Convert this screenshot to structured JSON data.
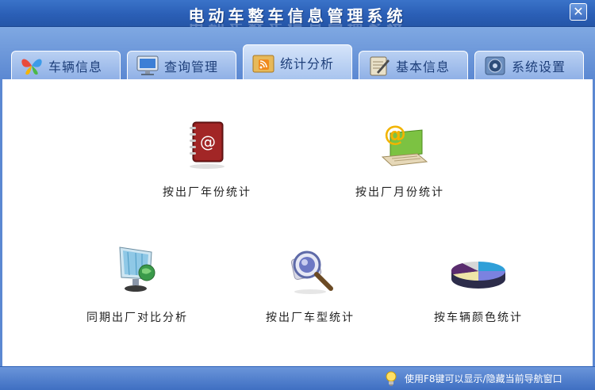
{
  "window": {
    "title": "电动车整车信息管理系统",
    "close_label": "✕"
  },
  "tabs": [
    {
      "label": "车辆信息",
      "icon": "butterfly-icon"
    },
    {
      "label": "查询管理",
      "icon": "monitor-icon"
    },
    {
      "label": "统计分析",
      "icon": "rss-folder-icon",
      "active": true
    },
    {
      "label": "基本信息",
      "icon": "notepad-pen-icon"
    },
    {
      "label": "系统设置",
      "icon": "settings-disk-icon"
    }
  ],
  "items": [
    {
      "label": "按出厂年份统计",
      "icon": "address-book-icon"
    },
    {
      "label": "按出厂月份统计",
      "icon": "email-laptop-icon"
    },
    {
      "label": "同期出厂对比分析",
      "icon": "globe-monitor-icon"
    },
    {
      "label": "按出厂车型统计",
      "icon": "magnifier-icon"
    },
    {
      "label": "按车辆颜色统计",
      "icon": "pie-chart-icon"
    }
  ],
  "status": {
    "hint": "使用F8键可以显示/隐藏当前导航窗口"
  }
}
